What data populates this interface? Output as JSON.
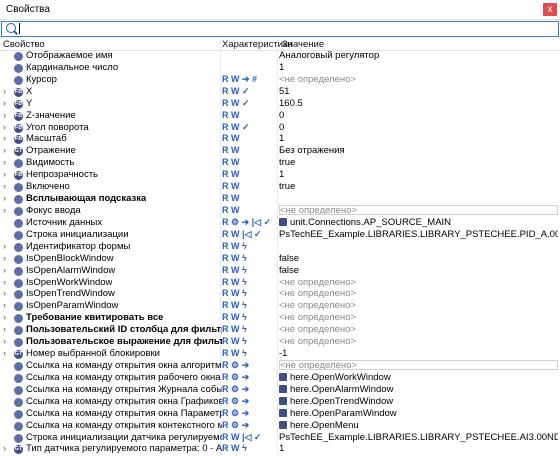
{
  "window": {
    "title": "Свойства",
    "close_label": "x"
  },
  "search": {
    "value": ""
  },
  "columns": {
    "property": "Свойство",
    "characteristics": "Характеристики",
    "value": "Значение"
  },
  "rows": [
    {
      "exp": "",
      "icon": "",
      "name": "Отображаемое имя",
      "bold": false,
      "chars": "",
      "value": "Аналоговый регулятор",
      "undef": false
    },
    {
      "exp": "",
      "icon": "",
      "name": "Кардинальное число",
      "bold": false,
      "chars": "",
      "value": "1",
      "undef": false
    },
    {
      "exp": "",
      "icon": "",
      "name": "Курсор",
      "bold": false,
      "chars": "R W ➔ #",
      "value": "<не определено>",
      "undef": true
    },
    {
      "exp": "›",
      "icon": "FB",
      "name": "X",
      "bold": false,
      "chars": "R W ✓",
      "value": "51",
      "undef": false
    },
    {
      "exp": "›",
      "icon": "FB",
      "name": "Y",
      "bold": false,
      "chars": "R W ✓",
      "value": "160.5",
      "undef": false
    },
    {
      "exp": "›",
      "icon": "FB",
      "name": "Z-значение",
      "bold": false,
      "chars": "R W",
      "value": "0",
      "undef": false
    },
    {
      "exp": "›",
      "icon": "FB",
      "name": "Угол поворота",
      "bold": false,
      "chars": "R W ✓",
      "value": "0",
      "undef": false
    },
    {
      "exp": "›",
      "icon": "FB",
      "name": "Масштаб",
      "bold": false,
      "chars": "R W",
      "value": "1",
      "undef": false
    },
    {
      "exp": "›",
      "icon": "GT",
      "name": "Отражение",
      "bold": false,
      "chars": "R W",
      "value": "Без отражения",
      "undef": false
    },
    {
      "exp": "›",
      "icon": "",
      "name": "Видимость",
      "bold": false,
      "chars": "R W",
      "value": "true",
      "undef": false
    },
    {
      "exp": "›",
      "icon": "FB",
      "name": "Непрозрачность",
      "bold": false,
      "chars": "R W",
      "value": "1",
      "undef": false
    },
    {
      "exp": "›",
      "icon": "",
      "name": "Включено",
      "bold": false,
      "chars": "R W",
      "value": "true",
      "undef": false
    },
    {
      "exp": "›",
      "icon": "",
      "name": "Всплывающая подсказка",
      "bold": true,
      "chars": "R W",
      "value": "",
      "undef": false
    },
    {
      "exp": "›",
      "icon": "",
      "name": "Фокус ввода",
      "bold": false,
      "chars": "R W",
      "value": "<не определено>",
      "undef": true,
      "boxed": true
    },
    {
      "exp": "",
      "icon": "",
      "name": "Источник данных",
      "bold": false,
      "chars": "R ⚙ ➔ |◁ ✓",
      "value": "unit.Connections.AP_SOURCE_MAIN",
      "undef": false,
      "vicon": true
    },
    {
      "exp": "",
      "icon": "",
      "name": "Строка инициализации",
      "bold": false,
      "chars": "R W |◁ ✓",
      "value": "PsTechEE_Example.LIBRARIES.LIBRARY_PSTECHEE.PID_A.00NDB01AA007R",
      "undef": false
    },
    {
      "exp": "›",
      "icon": "",
      "name": "Идентификатор формы",
      "bold": false,
      "chars": "R W ϟ",
      "value": "",
      "undef": false
    },
    {
      "exp": "›",
      "icon": "",
      "name": "IsOpenBlockWindow",
      "bold": false,
      "chars": "R W ϟ",
      "value": "false",
      "undef": false
    },
    {
      "exp": "›",
      "icon": "",
      "name": "IsOpenAlarmWindow",
      "bold": false,
      "chars": "R W ϟ",
      "value": "false",
      "undef": false
    },
    {
      "exp": "›",
      "icon": "",
      "name": "IsOpenWorkWindow",
      "bold": false,
      "chars": "R W ϟ",
      "value": "<не определено>",
      "undef": true
    },
    {
      "exp": "›",
      "icon": "",
      "name": "IsOpenTrendWindow",
      "bold": false,
      "chars": "R W ϟ",
      "value": "<не определено>",
      "undef": true
    },
    {
      "exp": "›",
      "icon": "",
      "name": "IsOpenParamWindow",
      "bold": false,
      "chars": "R W ϟ",
      "value": "<не определено>",
      "undef": true
    },
    {
      "exp": "›",
      "icon": "",
      "name": "Требование квитировать все",
      "bold": true,
      "chars": "R W ϟ",
      "value": "<не определено>",
      "undef": true
    },
    {
      "exp": "›",
      "icon": "",
      "name": "Пользовательский ID столбца для фильтра",
      "bold": true,
      "chars": "R W ϟ",
      "value": "<не определено>",
      "undef": true
    },
    {
      "exp": "›",
      "icon": "",
      "name": "Пользовательское выражение для фильтра",
      "bold": true,
      "chars": "R W ϟ",
      "value": "<не определено>",
      "undef": true
    },
    {
      "exp": "›",
      "icon": "GT",
      "name": "Номер выбранной блокировки",
      "bold": false,
      "chars": "R W ϟ",
      "value": "-1",
      "undef": false
    },
    {
      "exp": "",
      "icon": "",
      "name": "Ссылка на команду открытия окна алгоритма блокировки",
      "bold": false,
      "chars": "R ⚙ ➔",
      "value": "<не определено>",
      "undef": true,
      "boxed": true
    },
    {
      "exp": "",
      "icon": "",
      "name": "Ссылка на команду открытия рабочего окна",
      "bold": false,
      "chars": "R ⚙ ➔",
      "value": "here.OpenWorkWindow",
      "undef": false,
      "vicon": true
    },
    {
      "exp": "",
      "icon": "",
      "name": "Ссылка на команду открытия Журнала событий",
      "bold": false,
      "chars": "R ⚙ ➔",
      "value": "here.OpenAlarmWindow",
      "undef": false,
      "vicon": true
    },
    {
      "exp": "",
      "icon": "",
      "name": "Ссылка на команду открытия окна Графиков",
      "bold": false,
      "chars": "R ⚙ ➔",
      "value": "here.OpenTrendWindow",
      "undef": false,
      "vicon": true
    },
    {
      "exp": "",
      "icon": "",
      "name": "Ссылка на команду открытия окна Параметры",
      "bold": false,
      "chars": "R ⚙ ➔",
      "value": "here.OpenParamWindow",
      "undef": false,
      "vicon": true
    },
    {
      "exp": "",
      "icon": "",
      "name": "Ссылка на команду открытия контекстного меню",
      "bold": false,
      "chars": "R ⚙ ➔",
      "value": "here.OpenMenu",
      "undef": false,
      "vicon": true
    },
    {
      "exp": "",
      "icon": "",
      "name": "Строка инициализации датчика регулируемого параметра",
      "bold": false,
      "chars": "R W |◁ ✓",
      "value": "PsTechEE_Example.LIBRARIES.LIBRARY_PSTECHEE.AI3.00NDB01CT004",
      "undef": false
    },
    {
      "exp": "›",
      "icon": "GT",
      "name": "Тип датчика регулируемого параметра: 0 - AI1, 1 - AI3",
      "bold": false,
      "chars": "R W ϟ",
      "value": "1",
      "undef": false
    }
  ]
}
